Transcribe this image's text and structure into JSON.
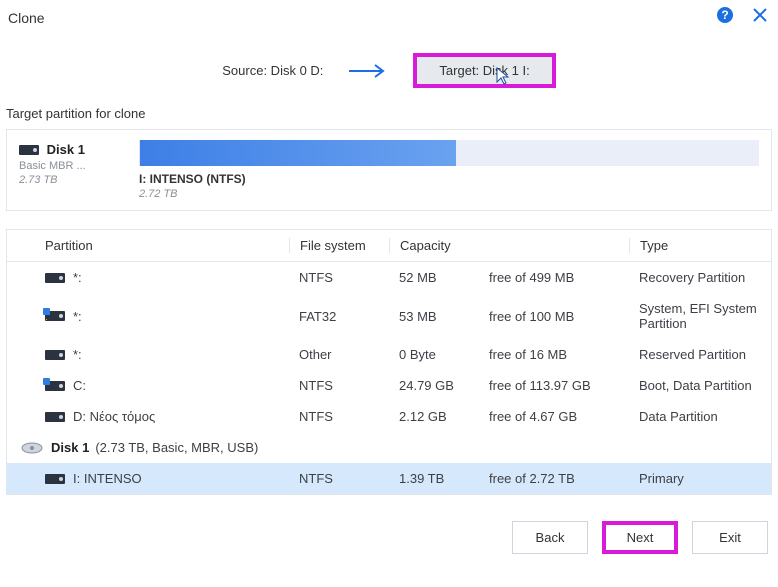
{
  "title": "Clone",
  "help_icon": "?",
  "close_icon": "×",
  "source_label": "Source: Disk 0 D:",
  "target_label": "Target: Disk 1 I:",
  "section_label": "Target partition for clone",
  "target_disk": {
    "name": "Disk 1",
    "subtitle": "Basic MBR ...",
    "size": "2.73 TB",
    "volume_label": "I: INTENSO (NTFS)",
    "volume_size": "2.72 TB"
  },
  "columns": {
    "partition": "Partition",
    "filesystem": "File system",
    "capacity": "Capacity",
    "type": "Type"
  },
  "rows": [
    {
      "icon": "plain",
      "name": "*:",
      "fs": "NTFS",
      "cap": "52 MB",
      "free": "free of 499 MB",
      "type": "Recovery Partition"
    },
    {
      "icon": "efi",
      "name": "*:",
      "fs": "FAT32",
      "cap": "53 MB",
      "free": "free of 100 MB",
      "type": "System, EFI System Partition"
    },
    {
      "icon": "plain",
      "name": "*:",
      "fs": "Other",
      "cap": "0 Byte",
      "free": "free of 16 MB",
      "type": "Reserved Partition"
    },
    {
      "icon": "blue",
      "name": "C:",
      "fs": "NTFS",
      "cap": "24.79 GB",
      "free": "free of 113.97 GB",
      "type": "Boot, Data Partition"
    },
    {
      "icon": "plain",
      "name": "D: Νέος τόμος",
      "fs": "NTFS",
      "cap": "2.12 GB",
      "free": "free of 4.67 GB",
      "type": "Data Partition"
    }
  ],
  "disk1_header": {
    "name": "Disk 1",
    "meta": "(2.73 TB, Basic, MBR, USB)"
  },
  "disk1_partition": {
    "icon": "plain",
    "name": "I: INTENSO",
    "fs": "NTFS",
    "cap": "1.39 TB",
    "free": "free of 2.72 TB",
    "type": "Primary"
  },
  "buttons": {
    "back": "Back",
    "next": "Next",
    "exit": "Exit"
  }
}
